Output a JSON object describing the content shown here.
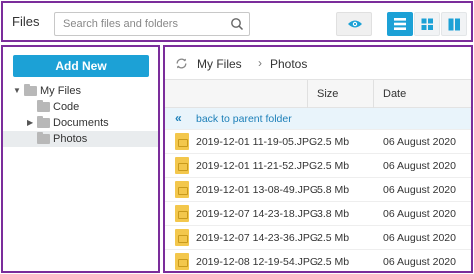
{
  "header": {
    "title": "Files",
    "search_placeholder": "Search files and folders"
  },
  "icons": {
    "search": "search-icon",
    "eye": "eye-icon",
    "list_view": "list-view-icon",
    "tiles_view": "grid-view-icon",
    "columns_view": "columns-view-icon",
    "refresh": "refresh-icon",
    "folder": "folder-icon",
    "image_file": "image-file-icon",
    "back": "double-chevron-left-icon"
  },
  "colors": {
    "accent": "#1ca1d6",
    "frame": "#7b2d9b",
    "file_icon": "#f3c74c"
  },
  "sidebar": {
    "add_new": "Add New",
    "tree": [
      {
        "label": "My Files",
        "expanded": true,
        "level": 0
      },
      {
        "label": "Code",
        "level": 1
      },
      {
        "label": "Documents",
        "collapsed": true,
        "level": 1
      },
      {
        "label": "Photos",
        "selected": true,
        "level": 1
      }
    ]
  },
  "breadcrumb": {
    "root": "My Files",
    "separator": "›",
    "current": "Photos"
  },
  "table": {
    "columns": [
      "Size",
      "Date"
    ],
    "parent_link": "back to parent folder",
    "rows": [
      {
        "name": "2019-12-01 11-19-05.JPG",
        "size": "2.5 Mb",
        "date": "06 August 2020"
      },
      {
        "name": "2019-12-01 11-21-52.JPG",
        "size": "2.5 Mb",
        "date": "06 August 2020"
      },
      {
        "name": "2019-12-01 13-08-49.JPG",
        "size": "5.8 Mb",
        "date": "06 August 2020"
      },
      {
        "name": "2019-12-07 14-23-18.JPG",
        "size": "3.8 Mb",
        "date": "06 August 2020"
      },
      {
        "name": "2019-12-07 14-23-36.JPG",
        "size": "2.5 Mb",
        "date": "06 August 2020"
      },
      {
        "name": "2019-12-08 12-19-54.JPG",
        "size": "2.5 Mb",
        "date": "06 August 2020"
      }
    ]
  }
}
